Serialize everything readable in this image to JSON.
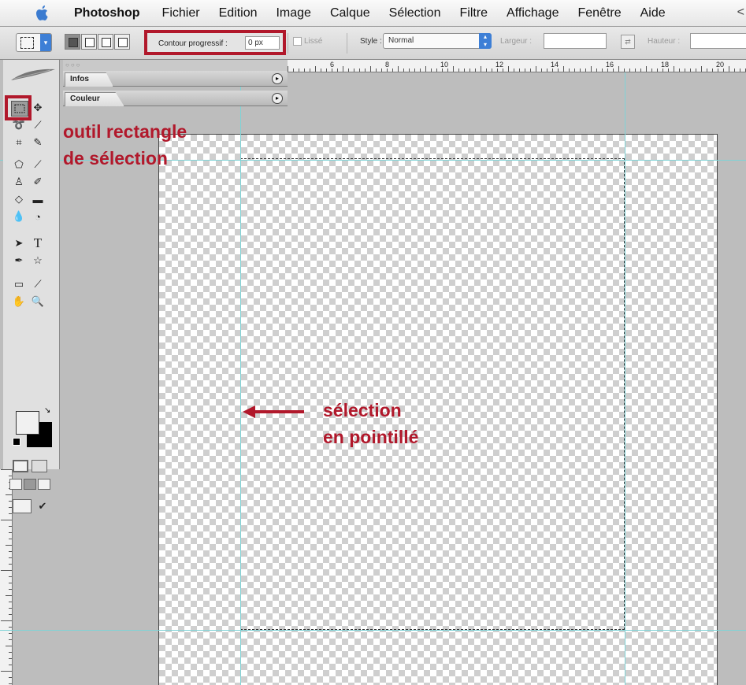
{
  "menubar": {
    "app_name": "Photoshop",
    "items": [
      "Fichier",
      "Edition",
      "Image",
      "Calque",
      "Sélection",
      "Filtre",
      "Affichage",
      "Fenêtre",
      "Aide"
    ],
    "extra": "<"
  },
  "options_bar": {
    "feather_label": "Contour progressif :",
    "feather_value": "0 px",
    "antialias_label": "Lissé",
    "style_label": "Style :",
    "style_value": "Normal",
    "width_label": "Largeur :",
    "height_label": "Hauteur :"
  },
  "palettes": {
    "infos_tab": "Infos",
    "couleur_tab": "Couleur"
  },
  "ruler_top_labels": [
    "6",
    "8",
    "10",
    "12",
    "14",
    "16",
    "18",
    "20"
  ],
  "annotations": {
    "tool_line1": "outil rectangle",
    "tool_line2": "de sélection",
    "selection_line1": "sélection",
    "selection_line2": "en pointillé"
  },
  "colors": {
    "annotation": "#b1182b",
    "guide": "#7fd3d6",
    "foreground_swatch": "#f1f1f1",
    "background_swatch": "#000000"
  },
  "icons": [
    "apple-icon",
    "rectangular-marquee-icon",
    "move-icon",
    "lasso-icon",
    "magic-wand-icon",
    "crop-icon",
    "slice-icon",
    "healing-brush-icon",
    "brush-icon",
    "clone-stamp-icon",
    "history-brush-icon",
    "eraser-icon",
    "gradient-icon",
    "blur-icon",
    "dodge-icon",
    "path-selection-icon",
    "type-icon",
    "pen-icon",
    "shape-icon",
    "notes-icon",
    "eyedropper-icon",
    "hand-icon",
    "zoom-icon"
  ]
}
